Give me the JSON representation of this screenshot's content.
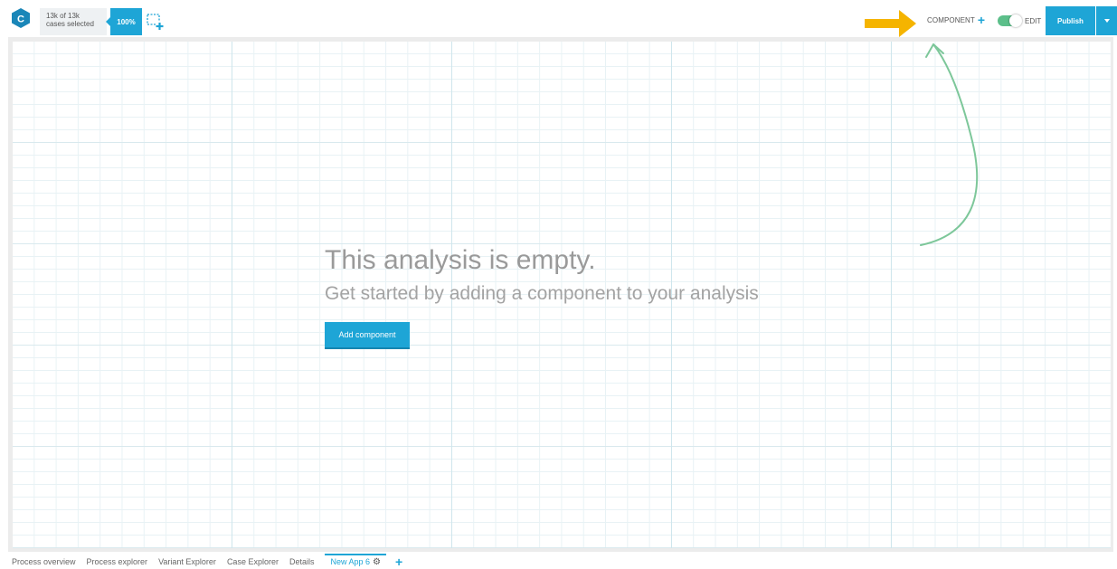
{
  "app": {
    "logo_letter": "C",
    "brand_color": "#1ea5d6"
  },
  "selection": {
    "count_line": "13k of 13k",
    "label_line": "cases selected",
    "percent": "100%",
    "add_selection_icon": "add-selection-icon"
  },
  "toolbar": {
    "component_label": "COMPONENT",
    "component_icon": "plus-icon",
    "edit_label": "EDIT",
    "edit_toggle_on": true,
    "publish_label": "Publish",
    "dropdown_icon": "caret-down-icon"
  },
  "annotations": {
    "arrow_color": "#f5b400",
    "curve_color": "#7dc79a"
  },
  "empty_state": {
    "title": "This analysis is empty.",
    "subtitle": "Get started by adding a component to your analysis",
    "button_label": "Add component"
  },
  "tabs": {
    "items": [
      "Process overview",
      "Process explorer",
      "Variant Explorer",
      "Case Explorer",
      "Details"
    ],
    "active": "New App 6",
    "active_icon": "gear-icon",
    "add_icon": "plus-icon"
  }
}
